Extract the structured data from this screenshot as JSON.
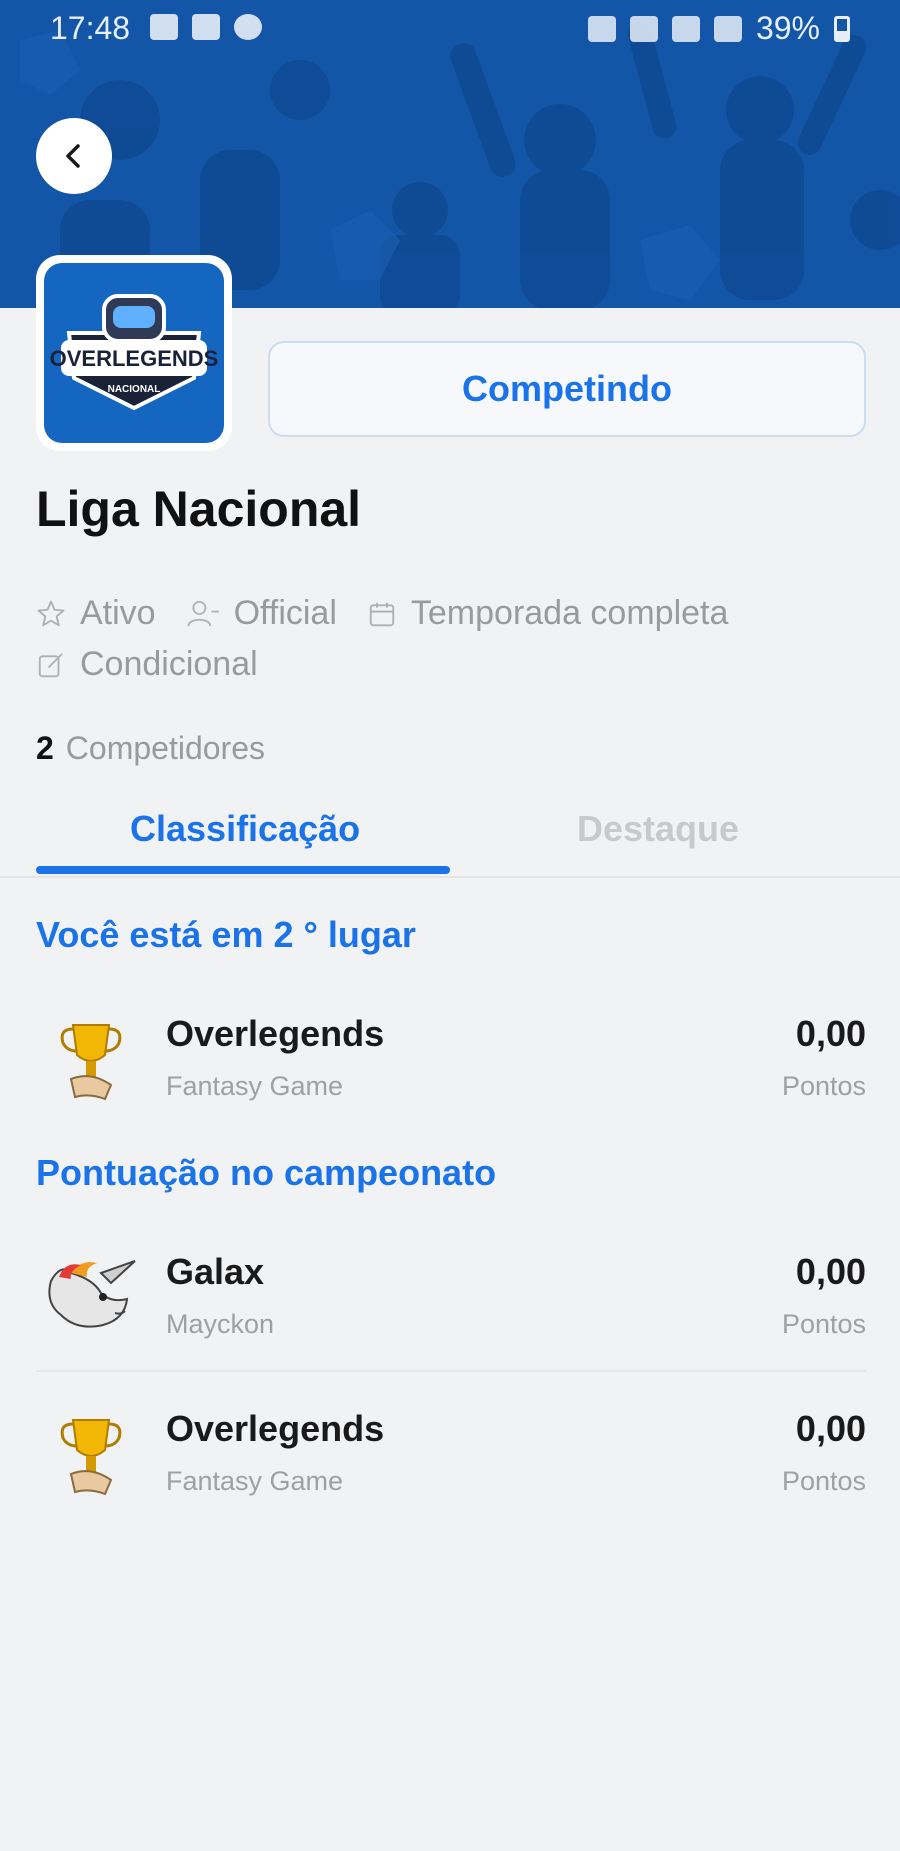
{
  "status_bar": {
    "time": "17:48",
    "battery": "39%",
    "left_icons": [
      "image-icon",
      "data-saver-icon",
      "s-app-icon"
    ],
    "right_icons": [
      "alarm-icon",
      "volte-icon",
      "wifi-icon",
      "signal-icon"
    ]
  },
  "header": {
    "back_icon": "chevron-left-icon",
    "banner_color": "#1356a8"
  },
  "league": {
    "logo_text": "OVERLEGENDS",
    "logo_subtext": "NACIONAL",
    "status_button": "Competindo",
    "title": "Liga Nacional",
    "meta": {
      "status": "Ativo",
      "type": "Official",
      "season": "Temporada completa",
      "mode": "Condicional"
    },
    "competitors_count": "2",
    "competitors_label": "Competidores"
  },
  "tabs": [
    {
      "label": "Classificação",
      "active": true
    },
    {
      "label": "Destaque",
      "active": false
    }
  ],
  "my_position": {
    "title": "Você está em 2 ° lugar",
    "entry": {
      "name": "Overlegends",
      "subtitle": "Fantasy Game",
      "score": "0,00",
      "unit": "Pontos",
      "avatar": "trophy-icon"
    }
  },
  "championship": {
    "title": "Pontuação no campeonato",
    "entries": [
      {
        "name": "Galax",
        "subtitle": "Mayckon",
        "score": "0,00",
        "unit": "Pontos",
        "avatar": "unicorn-icon"
      },
      {
        "name": "Overlegends",
        "subtitle": "Fantasy Game",
        "score": "0,00",
        "unit": "Pontos",
        "avatar": "trophy-icon"
      }
    ]
  },
  "colors": {
    "accent": "#1a73e8",
    "banner": "#1356a8",
    "background": "#f1f2f4",
    "muted_text": "#9a9a9a"
  }
}
